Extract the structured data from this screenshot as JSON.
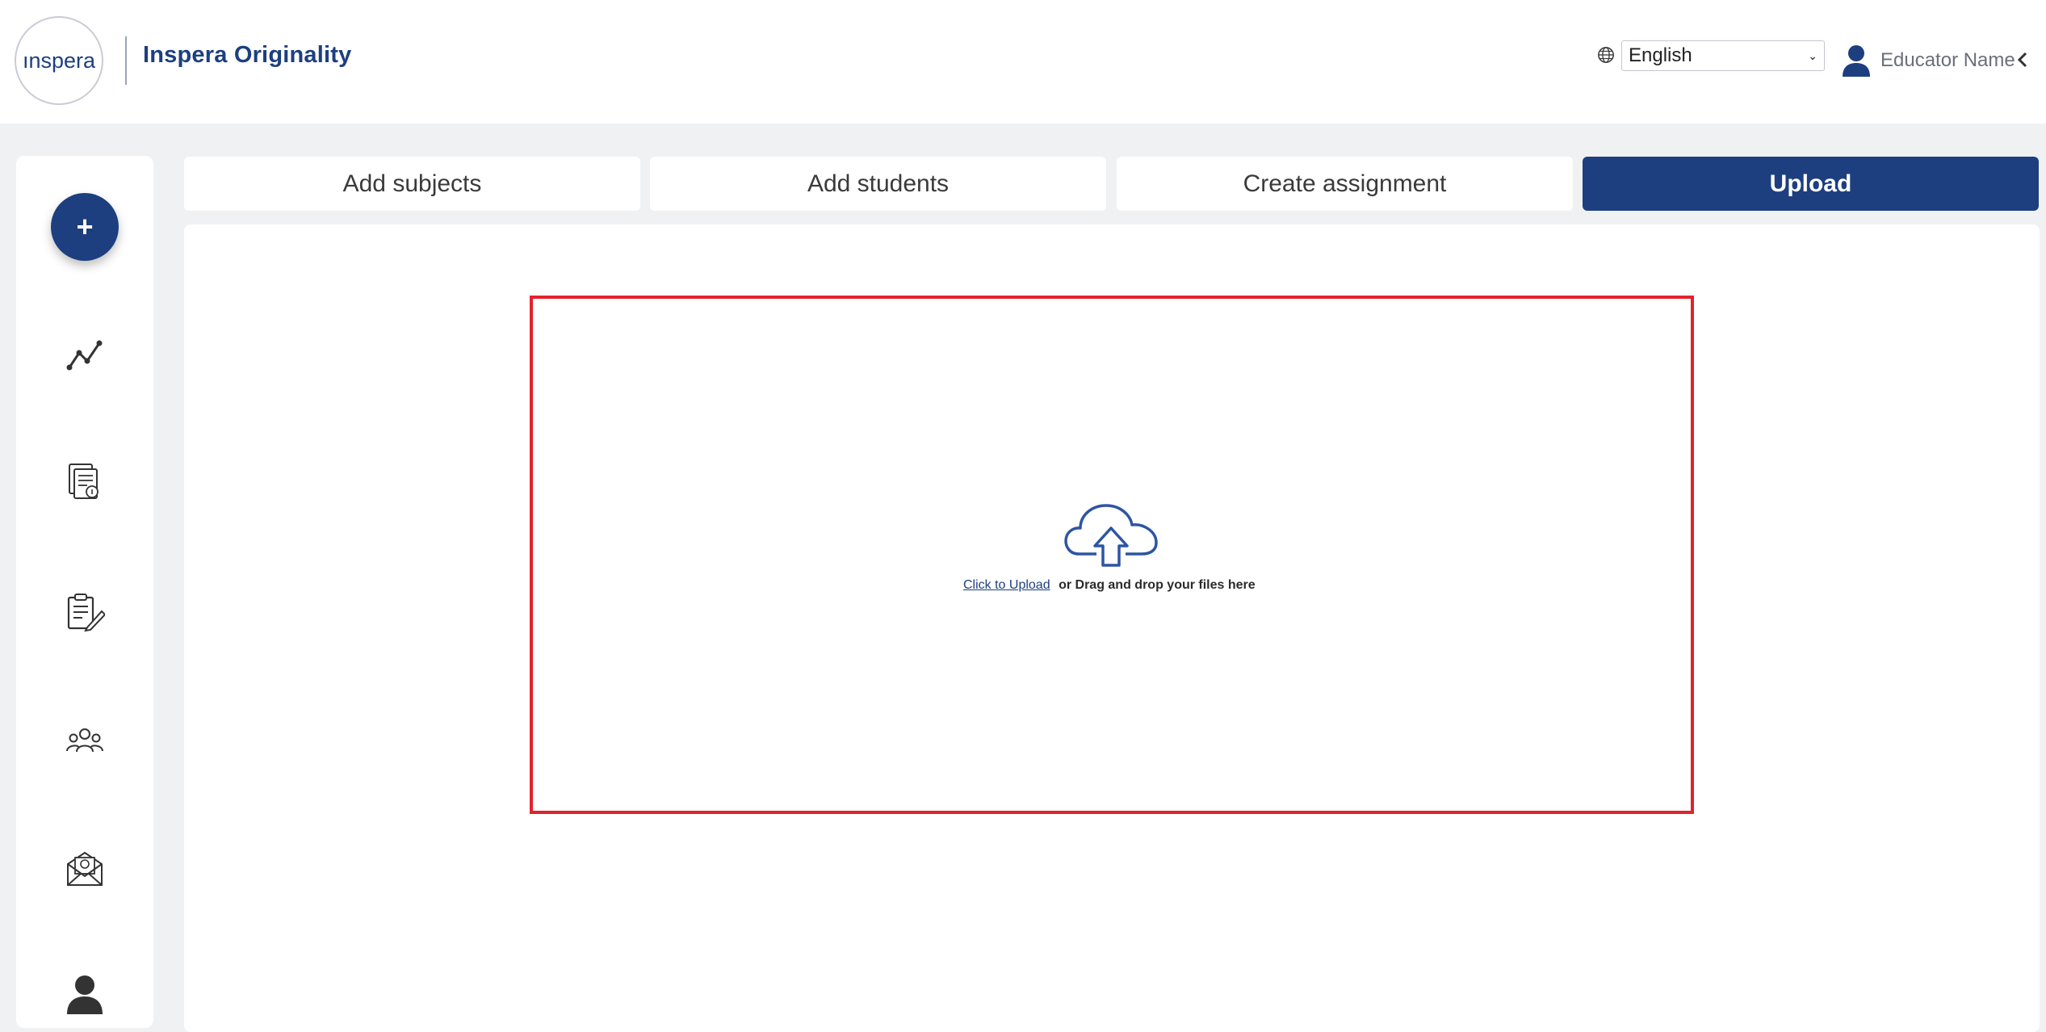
{
  "header": {
    "logo_text": "ınspera",
    "app_title": "Inspera Originality",
    "language": {
      "selected": "English"
    },
    "user": {
      "name": "Educator Name"
    }
  },
  "sidebar": {
    "add_button_label": "+",
    "items": [
      {
        "icon": "analytics-icon"
      },
      {
        "icon": "documents-icon"
      },
      {
        "icon": "assignments-icon"
      },
      {
        "icon": "students-icon"
      },
      {
        "icon": "help-mail-icon"
      },
      {
        "icon": "profile-icon"
      }
    ]
  },
  "tabs": [
    {
      "label": "Add subjects",
      "active": false
    },
    {
      "label": "Add students",
      "active": false
    },
    {
      "label": "Create assignment",
      "active": false
    },
    {
      "label": "Upload",
      "active": true
    }
  ],
  "upload": {
    "link_text": "Click to Upload",
    "instruction": "or Drag and drop your files here"
  },
  "colors": {
    "brand": "#1d3f7f",
    "highlight_border": "#e3222b",
    "background": "#f0f1f3"
  }
}
